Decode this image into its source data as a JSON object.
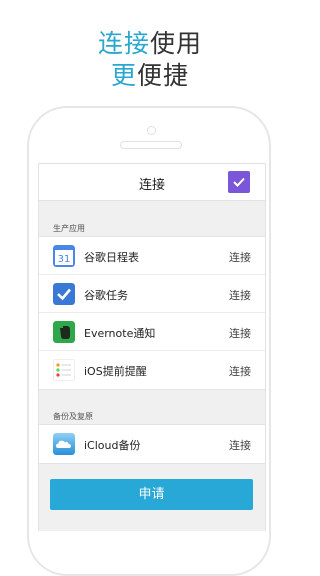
{
  "headline": {
    "line1_accent": "连接",
    "line1_rest": "使用",
    "line2_accent": "更",
    "line2_rest": "便捷"
  },
  "colors": {
    "accent": "#2aa7cf",
    "purple": "#7b56d8",
    "button": "#27a8d6"
  },
  "nav": {
    "title": "连接",
    "check_icon": "check-icon"
  },
  "sections": [
    {
      "label": "生产应用",
      "items": [
        {
          "label": "谷歌日程表",
          "action": "连接",
          "icon": "google-calendar-icon",
          "icon_text": "31"
        },
        {
          "label": "谷歌任务",
          "action": "连接",
          "icon": "google-tasks-icon"
        },
        {
          "label": "Evernote通知",
          "action": "连接",
          "icon": "evernote-icon"
        },
        {
          "label": "iOS提前提醒",
          "action": "连接",
          "icon": "ios-reminders-icon"
        }
      ]
    },
    {
      "label": "备份及复原",
      "items": [
        {
          "label": "iCloud备份",
          "action": "连接",
          "icon": "icloud-icon"
        }
      ]
    }
  ],
  "apply_label": "申请"
}
